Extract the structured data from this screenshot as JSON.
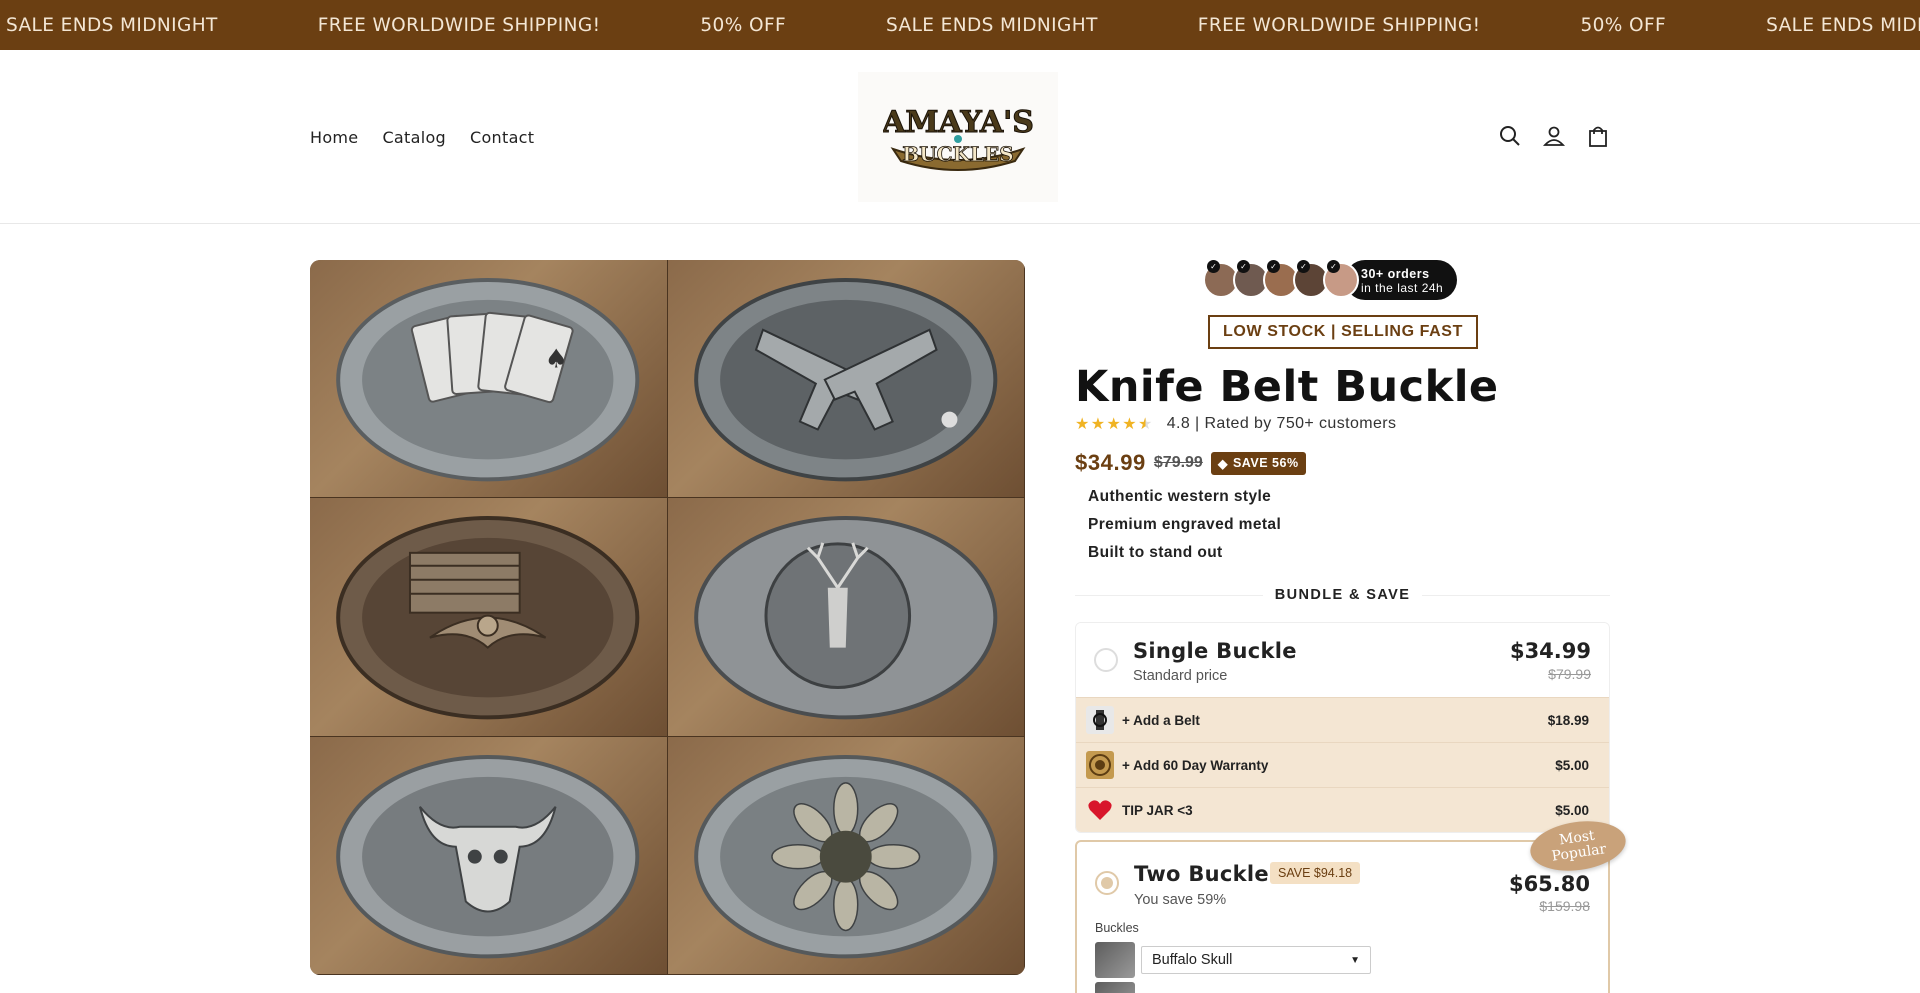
{
  "announcement": {
    "items": [
      "SALE ENDS MIDNIGHT",
      "FREE WORLDWIDE SHIPPING!",
      "50% OFF",
      "SALE ENDS MIDNIGHT",
      "FREE WORLDWIDE SHIPPING!",
      "50% OFF",
      "SALE ENDS MIDNIGHT"
    ]
  },
  "header": {
    "nav": [
      "Home",
      "Catalog",
      "Contact"
    ],
    "logo_text_top": "AMAYA'S",
    "logo_text_bottom": "BUCKLES",
    "icons": [
      "search-icon",
      "account-icon",
      "cart-icon"
    ]
  },
  "gallery": {
    "tiles": [
      "cards-buckle",
      "pistols-buckle",
      "eagle-flag-buckle",
      "deer-buckle",
      "buffalo-skull-buckle",
      "sunflower-buckle"
    ]
  },
  "product": {
    "orders_big": "30+ orders",
    "orders_small": "in the last 24h",
    "low_stock": "LOW STOCK | SELLING FAST",
    "title": "Knife Belt Buckle",
    "rating_text": "4.8 | Rated by 750+ customers",
    "rating": 4.5,
    "price": "$34.99",
    "compare_price": "$79.99",
    "save_badge": "SAVE 56%",
    "bullets": [
      "Authentic western style",
      "Premium engraved metal",
      "Built to stand out"
    ]
  },
  "bundle": {
    "heading": "BUNDLE & SAVE",
    "single": {
      "title": "Single Buckle",
      "subtitle": "Standard price",
      "price": "$34.99",
      "compare": "$79.99"
    },
    "addons": [
      {
        "label": "+ Add a Belt",
        "price": "$18.99"
      },
      {
        "label": "+ Add 60 Day Warranty",
        "price": "$5.00"
      },
      {
        "label": "TIP JAR <3",
        "price": "$5.00"
      }
    ],
    "two": {
      "title": "Two Buckles",
      "save_tag": "SAVE $94.18",
      "subtitle": "You save 59%",
      "price": "$65.80",
      "compare": "$159.98",
      "badge_line1": "Most",
      "badge_line2": "Popular",
      "buckles_label": "Buckles",
      "variant_selected": "Buffalo Skull"
    }
  },
  "colors": {
    "brand_brown": "#6b3f12",
    "addon_bg": "#f4e6d3",
    "star": "#f0b323"
  }
}
